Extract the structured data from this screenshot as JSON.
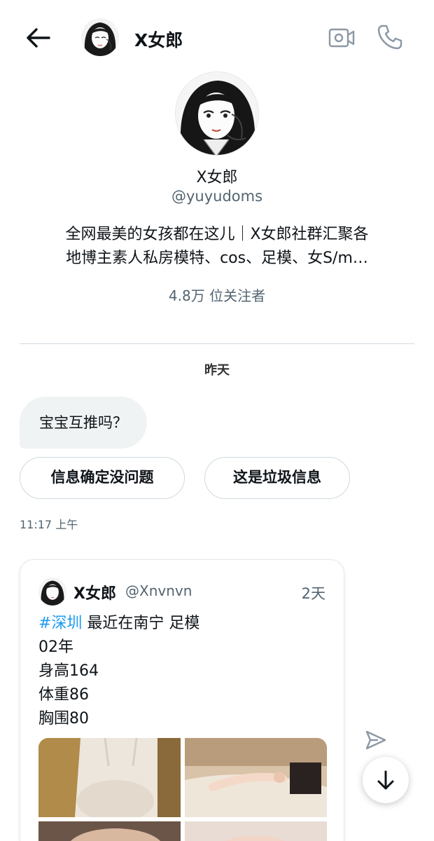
{
  "header": {
    "title": "X女郎",
    "back_icon": "arrow-left-icon",
    "video_icon": "video-call-icon",
    "phone_icon": "phone-icon"
  },
  "profile": {
    "name": "X女郎",
    "handle": "@yuyudoms",
    "bio_line1": "全网最美的女孩都在这儿｜X女郎社群汇聚各",
    "bio_line2": "地博主素人私房模特、cos、足模、女S/m…",
    "followers": "4.8万 位关注者"
  },
  "conversation": {
    "date_separator": "昨天",
    "message": "宝宝互推吗？",
    "quick_replies": [
      "信息确定没问题",
      "这是垃圾信息"
    ],
    "timestamp": "11:17 上午"
  },
  "quoted_tweet": {
    "author_name": "X女郎",
    "author_handle": "@Xnvnvn",
    "time": "2天",
    "hashtag": "#深圳",
    "line1_rest": " 最近在南宁 足模",
    "line2": "02年",
    "line3": "身高164",
    "line4": "体重86",
    "line5": "胸围80"
  },
  "colors": {
    "accent": "#1d9bf0",
    "secondary_text": "#536471",
    "bubble_bg": "#eff3f4",
    "border": "#cfd9de"
  }
}
